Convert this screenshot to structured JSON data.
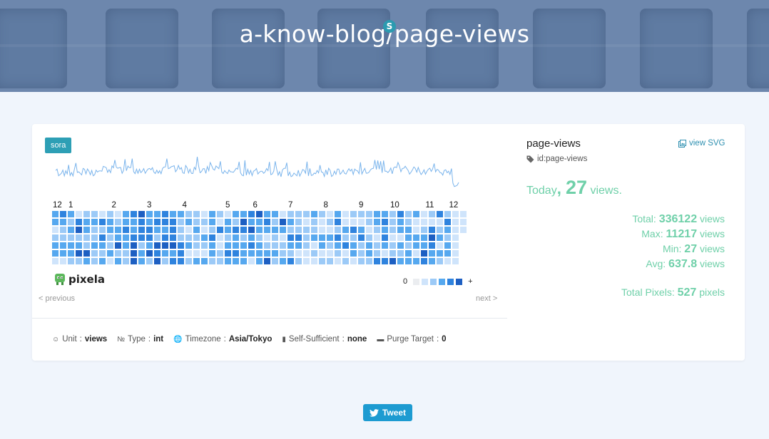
{
  "header": {
    "title": "a-know-blog/page-views",
    "badge": "S"
  },
  "card": {
    "user_tag": "sora",
    "months": [
      "12",
      "1",
      "2",
      "3",
      "4",
      "5",
      "6",
      "7",
      "8",
      "9",
      "10",
      "11",
      "12"
    ],
    "logo_text": "pixela",
    "legend": {
      "low_label": "0",
      "high_label": "+",
      "colors": [
        "#ebedf0",
        "#cfe4fb",
        "#9ccaf7",
        "#56a8ef",
        "#2f83de",
        "#1d5fc2"
      ]
    },
    "nav": {
      "previous": "< previous",
      "next": "next >"
    },
    "info": [
      {
        "icon": "unit-icon",
        "label": "Unit",
        "value": "views"
      },
      {
        "icon": "type-icon",
        "label": "Type",
        "value": "int"
      },
      {
        "icon": "globe-icon",
        "label": "Timezone",
        "value": "Asia/Tokyo"
      },
      {
        "icon": "battery-icon",
        "label": "Self-Sufficient",
        "value": "none"
      },
      {
        "icon": "trash-icon",
        "label": "Purge Target",
        "value": "0"
      }
    ]
  },
  "sidebar": {
    "graph_name": "page-views",
    "view_svg": "view SVG",
    "graph_id": "id:page-views",
    "today_label": "Today",
    "today_value": "27",
    "today_unit": "views.",
    "stats": [
      {
        "label": "Total",
        "value": "336122",
        "unit": "views"
      },
      {
        "label": "Max",
        "value": "11217",
        "unit": "views"
      },
      {
        "label": "Min",
        "value": "27",
        "unit": "views"
      },
      {
        "label": "Avg",
        "value": "637.8",
        "unit": "views"
      }
    ],
    "total_pixels_label": "Total Pixels",
    "total_pixels_value": "527",
    "total_pixels_unit": "pixels"
  },
  "tweet_label": "Tweet"
}
